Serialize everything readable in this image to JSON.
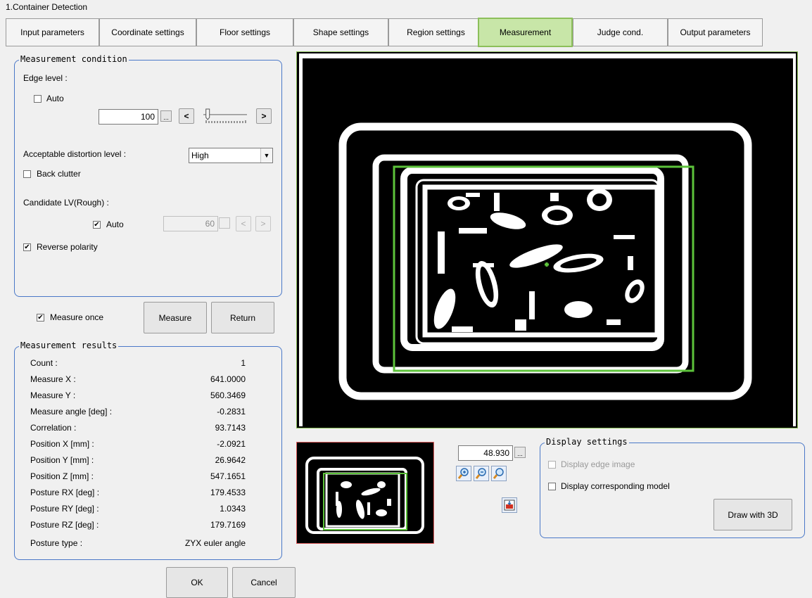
{
  "window": {
    "title": "1.Container Detection"
  },
  "tabs": [
    "Input parameters",
    "Coordinate settings",
    "Floor settings",
    "Shape settings",
    "Region settings",
    "Measurement",
    "Judge cond.",
    "Output parameters"
  ],
  "active_tab": "Measurement",
  "measurement_condition": {
    "title": "Measurement condition",
    "edge_level_label": "Edge level :",
    "edge_auto_label": "Auto",
    "edge_auto_checked": false,
    "edge_level_value": "100",
    "edge_level_fraction": 0.1,
    "dec_label": "<",
    "inc_label": ">",
    "ellipsis": "...",
    "distortion_label": "Acceptable distortion level :",
    "distortion_value": "High",
    "back_clutter_label": "Back clutter",
    "back_clutter_checked": false,
    "candidate_label": "Candidate LV(Rough) :",
    "candidate_auto_label": "Auto",
    "candidate_auto_checked": true,
    "candidate_value": "60",
    "reverse_polarity_label": "Reverse polarity",
    "reverse_polarity_checked": true
  },
  "actions": {
    "measure_once_label": "Measure once",
    "measure_once_checked": true,
    "measure_label": "Measure",
    "return_label": "Return",
    "ok_label": "OK",
    "cancel_label": "Cancel"
  },
  "measurement_results": {
    "title": "Measurement results",
    "rows": [
      {
        "label": "Count :",
        "value": "1"
      },
      {
        "label": "Measure X :",
        "value": "641.0000"
      },
      {
        "label": "Measure Y :",
        "value": "560.3469"
      },
      {
        "label": "Measure angle [deg] :",
        "value": "-0.2831"
      },
      {
        "label": "Correlation :",
        "value": "93.7143"
      },
      {
        "label": "Position X [mm] :",
        "value": "-2.0921"
      },
      {
        "label": "Position Y [mm] :",
        "value": "26.9642"
      },
      {
        "label": "Position Z [mm] :",
        "value": "547.1651"
      },
      {
        "label": "Posture RX [deg] :",
        "value": "179.4533"
      },
      {
        "label": "Posture RY [deg] :",
        "value": "1.0343"
      },
      {
        "label": "Posture RZ [deg] :",
        "value": "179.7169"
      },
      {
        "label": "Posture type :",
        "value": "ZYX euler angle"
      }
    ]
  },
  "zoom": {
    "value": "48.930"
  },
  "display_settings": {
    "title": "Display settings",
    "edge_image_label": "Display edge image",
    "edge_image_checked": false,
    "edge_image_enabled": false,
    "corresponding_model_label": "Display corresponding model",
    "corresponding_model_checked": false,
    "draw3d_label": "Draw with 3D"
  },
  "colors": {
    "active_tab": "#c8e6a8",
    "group_border": "#4a78c8",
    "detection_box": "#5cc23a",
    "thumb_border": "#e06060"
  },
  "icons": [
    "zoom-in-icon",
    "zoom-out-icon",
    "zoom-fit-icon",
    "fit-to-window-icon",
    "checkmark-icon",
    "dropdown-arrow-icon"
  ]
}
